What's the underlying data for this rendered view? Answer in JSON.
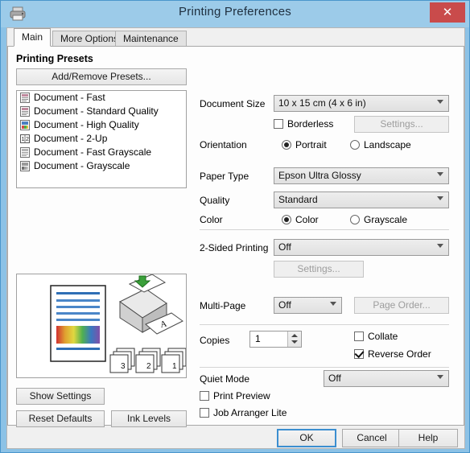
{
  "window": {
    "title": "Printing Preferences",
    "icon": "printer-icon",
    "close_label": "✕",
    "titlebar_color": "#9ccbe9",
    "close_color": "#c94b4b"
  },
  "tabs": [
    {
      "label": "Main",
      "active": true
    },
    {
      "label": "More Options",
      "active": false
    },
    {
      "label": "Maintenance",
      "active": false
    }
  ],
  "presets": {
    "heading": "Printing Presets",
    "add_remove_label": "Add/Remove Presets...",
    "items": [
      {
        "label": "Document - Fast",
        "icon": "document-icon"
      },
      {
        "label": "Document - Standard Quality",
        "icon": "document-icon"
      },
      {
        "label": "Document - High Quality",
        "icon": "document-color-icon"
      },
      {
        "label": "Document - 2-Up",
        "icon": "two-up-icon"
      },
      {
        "label": "Document - Fast Grayscale",
        "icon": "document-gray-icon"
      },
      {
        "label": "Document - Grayscale",
        "icon": "document-gray-icon"
      }
    ]
  },
  "left_buttons": {
    "show_settings": "Show Settings",
    "reset_defaults": "Reset Defaults",
    "ink_levels": "Ink Levels"
  },
  "settings": {
    "document_size": {
      "label": "Document Size",
      "value": "10 x 15 cm (4 x 6 in)"
    },
    "borderless": {
      "label": "Borderless",
      "checked": false
    },
    "borderless_settings": {
      "label": "Settings...",
      "enabled": false
    },
    "orientation": {
      "label": "Orientation",
      "portrait": "Portrait",
      "landscape": "Landscape",
      "value": "Portrait"
    },
    "paper_type": {
      "label": "Paper Type",
      "value": "Epson Ultra Glossy"
    },
    "quality": {
      "label": "Quality",
      "value": "Standard"
    },
    "color": {
      "label": "Color",
      "color_option": "Color",
      "grayscale_option": "Grayscale",
      "value": "Color"
    },
    "two_sided": {
      "label": "2-Sided Printing",
      "value": "Off"
    },
    "two_sided_settings": {
      "label": "Settings...",
      "enabled": false
    },
    "multi_page": {
      "label": "Multi-Page",
      "value": "Off"
    },
    "page_order": {
      "label": "Page Order...",
      "enabled": false
    },
    "copies": {
      "label": "Copies",
      "value": "1"
    },
    "collate": {
      "label": "Collate",
      "checked": false
    },
    "reverse_order": {
      "label": "Reverse Order",
      "checked": true
    },
    "quiet_mode": {
      "label": "Quiet Mode",
      "value": "Off"
    },
    "print_preview": {
      "label": "Print Preview",
      "checked": false
    },
    "job_arranger": {
      "label": "Job Arranger Lite",
      "checked": false
    }
  },
  "preview": {
    "page_stack_labels": [
      "3",
      "2",
      "1"
    ],
    "sheet_letter": "A"
  },
  "dialog_buttons": {
    "ok": "OK",
    "cancel": "Cancel",
    "help": "Help"
  }
}
